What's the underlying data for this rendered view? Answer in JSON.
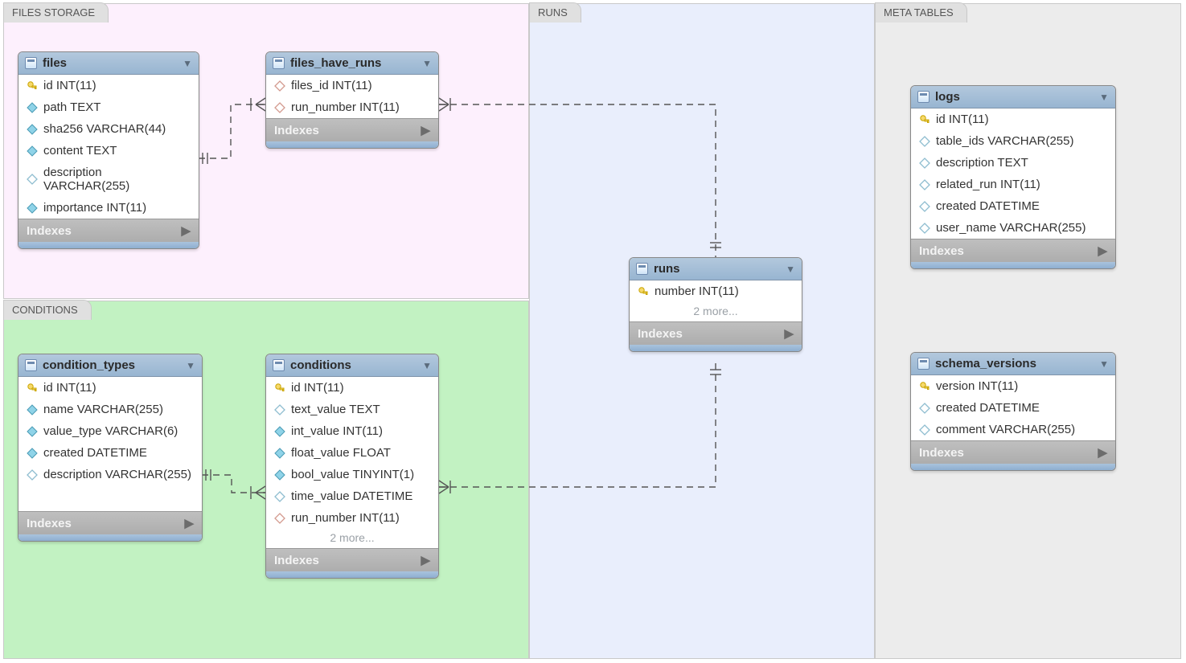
{
  "regions": {
    "files": "FILES STORAGE",
    "conditions": "CONDITIONS",
    "runs": "RUNS",
    "meta": "META TABLES"
  },
  "indexes_label": "Indexes",
  "tables": {
    "files": {
      "name": "files",
      "cols": [
        {
          "icon": "key",
          "label": "id INT(11)"
        },
        {
          "icon": "dia-fill",
          "label": "path TEXT"
        },
        {
          "icon": "dia-fill",
          "label": "sha256 VARCHAR(44)"
        },
        {
          "icon": "dia-fill",
          "label": "content TEXT"
        },
        {
          "icon": "dia-open",
          "label": "description VARCHAR(255)"
        },
        {
          "icon": "dia-fill",
          "label": "importance INT(11)"
        }
      ]
    },
    "files_have_runs": {
      "name": "files_have_runs",
      "cols": [
        {
          "icon": "dia-red",
          "label": "files_id INT(11)"
        },
        {
          "icon": "dia-red",
          "label": "run_number INT(11)"
        }
      ]
    },
    "condition_types": {
      "name": "condition_types",
      "cols": [
        {
          "icon": "key",
          "label": "id INT(11)"
        },
        {
          "icon": "dia-fill",
          "label": "name VARCHAR(255)"
        },
        {
          "icon": "dia-fill",
          "label": "value_type VARCHAR(6)"
        },
        {
          "icon": "dia-fill",
          "label": "created DATETIME"
        },
        {
          "icon": "dia-open",
          "label": "description VARCHAR(255)"
        }
      ]
    },
    "conditions": {
      "name": "conditions",
      "cols": [
        {
          "icon": "key",
          "label": "id INT(11)"
        },
        {
          "icon": "dia-open",
          "label": "text_value TEXT"
        },
        {
          "icon": "dia-fill",
          "label": "int_value INT(11)"
        },
        {
          "icon": "dia-fill",
          "label": "float_value FLOAT"
        },
        {
          "icon": "dia-fill",
          "label": "bool_value TINYINT(1)"
        },
        {
          "icon": "dia-open",
          "label": "time_value DATETIME"
        },
        {
          "icon": "dia-red",
          "label": "run_number INT(11)"
        }
      ],
      "more": "2 more..."
    },
    "runs": {
      "name": "runs",
      "cols": [
        {
          "icon": "key",
          "label": "number INT(11)"
        }
      ],
      "more": "2 more..."
    },
    "logs": {
      "name": "logs",
      "cols": [
        {
          "icon": "key",
          "label": "id INT(11)"
        },
        {
          "icon": "dia-open",
          "label": "table_ids VARCHAR(255)"
        },
        {
          "icon": "dia-open",
          "label": "description TEXT"
        },
        {
          "icon": "dia-open",
          "label": "related_run INT(11)"
        },
        {
          "icon": "dia-open",
          "label": "created DATETIME"
        },
        {
          "icon": "dia-open",
          "label": "user_name VARCHAR(255)"
        }
      ]
    },
    "schema_versions": {
      "name": "schema_versions",
      "cols": [
        {
          "icon": "key",
          "label": "version INT(11)"
        },
        {
          "icon": "dia-open",
          "label": "created DATETIME"
        },
        {
          "icon": "dia-open",
          "label": "comment VARCHAR(255)"
        }
      ]
    }
  }
}
